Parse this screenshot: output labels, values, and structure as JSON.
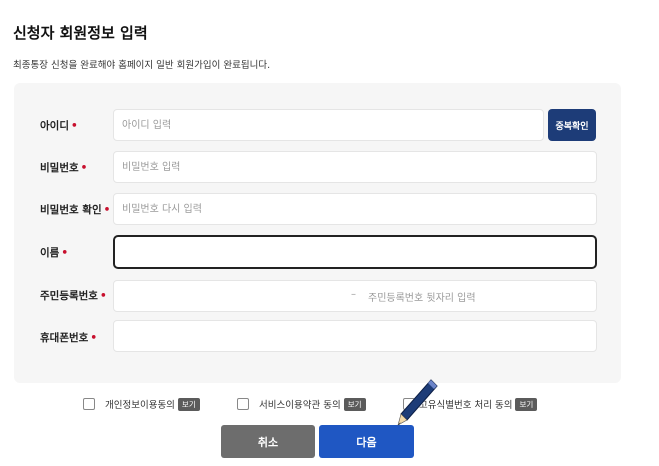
{
  "header": {
    "title": "신청자 회원정보 입력",
    "subtitle": "최종통장 신청을 완료해야 홈페이지 일반 회원가입이 완료됩니다."
  },
  "form": {
    "required_mark": "•",
    "id": {
      "label": "아이디",
      "placeholder": "아이디 입력",
      "value": ""
    },
    "dup_check_label": "중복확인",
    "password": {
      "label": "비밀번호",
      "placeholder": "비밀번호 입력",
      "value": ""
    },
    "password_confirm": {
      "label": "비밀번호 확인",
      "placeholder": "비밀번호 다시 입력",
      "value": ""
    },
    "name": {
      "label": "이름",
      "placeholder": "",
      "value": ""
    },
    "rrn": {
      "label": "주민등록번호",
      "separator": "–",
      "back_placeholder": "주민등록번호 뒷자리 입력"
    },
    "phone": {
      "label": "휴대폰번호",
      "placeholder": "",
      "value": ""
    }
  },
  "agreements": [
    {
      "label": "개인정보이용동의",
      "view_label": "보기",
      "checked": false
    },
    {
      "label": "서비스이용약관 동의",
      "view_label": "보기",
      "checked": false
    },
    {
      "label": "고유식별번호 처리 동의",
      "view_label": "보기",
      "checked": false
    }
  ],
  "actions": {
    "cancel_label": "취소",
    "next_label": "다음"
  },
  "colors": {
    "primary": "#1f57c3",
    "navy": "#1d3c78",
    "required": "#c8102e",
    "cancel": "#6d6d6d"
  },
  "icons": {
    "cursor": "pen-cursor-icon"
  }
}
